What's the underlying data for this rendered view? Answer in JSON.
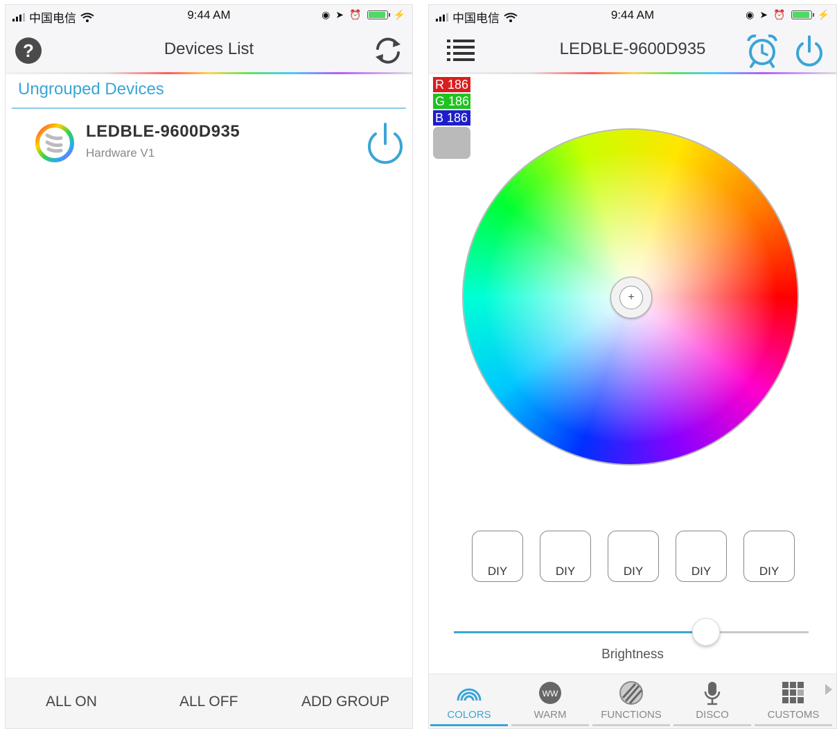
{
  "status_bar": {
    "carrier": "中国电信",
    "time": "9:44 AM"
  },
  "left_screen": {
    "title": "Devices List",
    "section_header": "Ungrouped Devices",
    "device": {
      "name": "LEDBLE-9600D935",
      "subtitle": "Hardware V1"
    },
    "bottom_buttons": {
      "all_on": "ALL ON",
      "all_off": "ALL OFF",
      "add_group": "ADD GROUP"
    },
    "icons": {
      "help": "question-circle-icon",
      "refresh": "refresh-icon",
      "device_logo": "led-strip-rainbow-icon",
      "power": "power-icon"
    }
  },
  "right_screen": {
    "title": "LEDBLE-9600D935",
    "rgb": {
      "r_label": "R",
      "r_value": "186",
      "g_label": "G",
      "g_value": "186",
      "b_label": "B",
      "b_value": "186",
      "swatch_color": "#bababa"
    },
    "diy_buttons": [
      "DIY",
      "DIY",
      "DIY",
      "DIY",
      "DIY"
    ],
    "brightness": {
      "label": "Brightness",
      "value_fraction": 0.71
    },
    "tabs": [
      {
        "label": "COLORS",
        "icon": "rainbow-icon",
        "active": true
      },
      {
        "label": "WARM",
        "icon": "ww-circle-icon",
        "active": false
      },
      {
        "label": "FUNCTIONS",
        "icon": "striped-circle-icon",
        "active": false
      },
      {
        "label": "DISCO",
        "icon": "microphone-icon",
        "active": false
      },
      {
        "label": "CUSTOMS",
        "icon": "grid-icon",
        "active": false
      }
    ],
    "icons": {
      "menu": "menu-list-icon",
      "alarm": "alarm-clock-icon",
      "power": "power-icon"
    }
  },
  "colors": {
    "accent": "#3aa5d6",
    "red": "#d81e1e",
    "green": "#1fc21f",
    "blue": "#1e1ec8"
  }
}
